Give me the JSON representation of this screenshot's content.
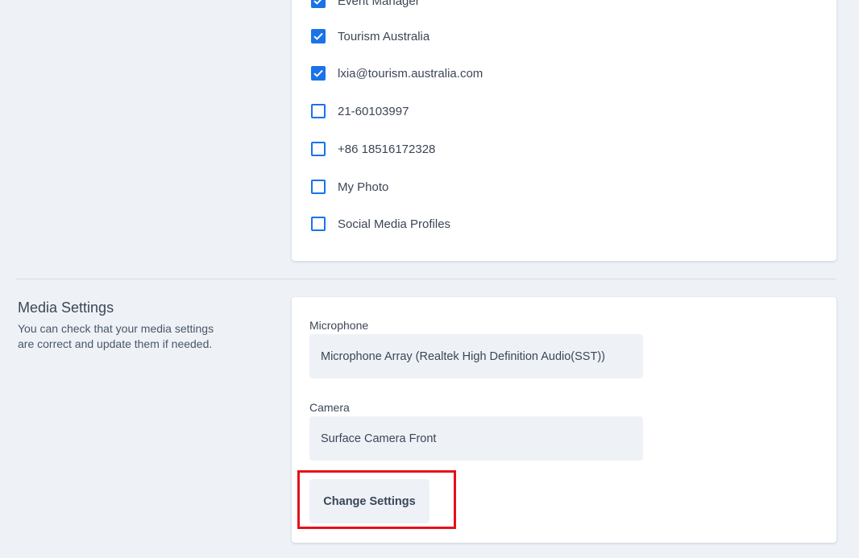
{
  "share_options": {
    "items": [
      {
        "label": "Event Manager",
        "checked": true
      },
      {
        "label": "Tourism Australia",
        "checked": true
      },
      {
        "label": "lxia@tourism.australia.com",
        "checked": true
      },
      {
        "label": "21-60103997",
        "checked": false
      },
      {
        "label": "+86 18516172328",
        "checked": false
      },
      {
        "label": "My Photo",
        "checked": false
      },
      {
        "label": "Social Media Profiles",
        "checked": false
      }
    ]
  },
  "media_settings": {
    "title": "Media Settings",
    "description": "You can check that your media settings are correct and update them if needed.",
    "microphone_label": "Microphone",
    "microphone_value": "Microphone Array (Realtek High Definition Audio(SST))",
    "camera_label": "Camera",
    "camera_value": "Surface Camera Front",
    "change_button_label": "Change Settings"
  },
  "colors": {
    "accent": "#1a73e8",
    "highlight": "#e8101a",
    "background": "#eef2f7"
  }
}
